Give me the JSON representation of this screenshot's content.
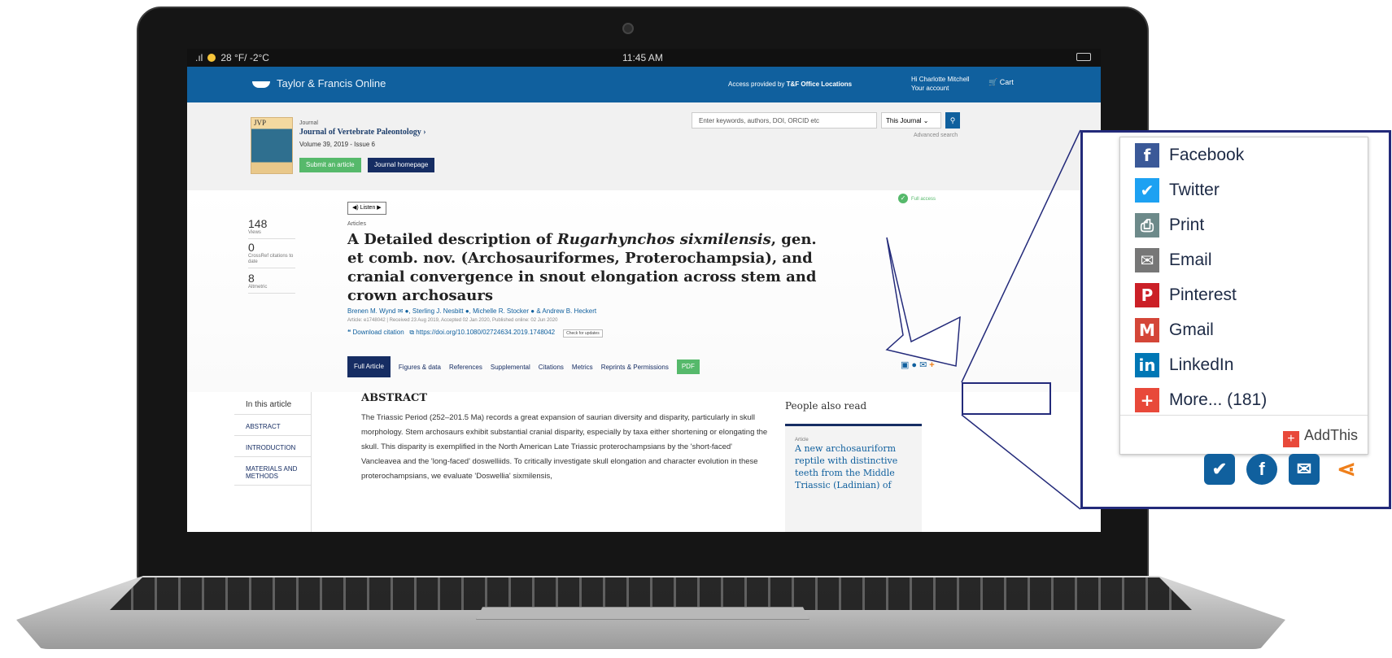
{
  "status": {
    "signal": ".ıl",
    "weather": "28 °F/ -2°C",
    "time": "11:45 AM"
  },
  "header": {
    "brand": "Taylor & Francis Online",
    "access_prefix": "Access provided by ",
    "access_org": "T&F Office Locations",
    "user_greeting": "Hi Charlotte Mitchell",
    "account_label": "Your account",
    "cart": "Cart"
  },
  "journal": {
    "label": "Journal",
    "cover_text": "JVP",
    "title": "Journal of Vertebrate Paleontology ›",
    "volume": "Volume 39, 2019 - Issue 6",
    "submit": "Submit an article",
    "homepage": "Journal homepage"
  },
  "search": {
    "placeholder": "Enter keywords, authors, DOI, ORCID etc",
    "scope": "This Journal",
    "advanced": "Advanced search"
  },
  "metrics": [
    {
      "value": "148",
      "label": "Views"
    },
    {
      "value": "0",
      "label": "CrossRef citations to date"
    },
    {
      "value": "8",
      "label": "Altmetric"
    }
  ],
  "article": {
    "listen": "◀) Listen  ▶",
    "type": "Articles",
    "full_access": "Full access",
    "title_before": "A Detailed description of ",
    "title_italic": "Rugarhynchos sixmilensis",
    "title_after": ", gen. et comb. nov. (Archosauriformes, Proterochampsia), and cranial convergence in snout elongation across stem and crown archosaurs",
    "authors": "Brenen M. Wynd ✉ ●, Sterling J. Nesbitt ●, Michelle R. Stocker ● & Andrew B. Heckert",
    "meta": "Article: e1748042 | Received 23 Aug 2019, Accepted 02 Jan 2020, Published online: 02 Jun 2020",
    "download": "❝ Download citation",
    "doi": "https://doi.org/10.1080/02724634.2019.1748042",
    "check": "Check for updates"
  },
  "tabs": [
    "Full Article",
    "Figures & data",
    "References",
    "Supplemental",
    "Citations",
    "Metrics",
    "Reprints & Permissions",
    "PDF"
  ],
  "toc": {
    "heading": "In this article",
    "items": [
      "ABSTRACT",
      "INTRODUCTION",
      "MATERIALS AND METHODS"
    ]
  },
  "abstract": {
    "heading": "ABSTRACT",
    "text": "The Triassic Period (252–201.5 Ma) records a great expansion of saurian diversity and disparity, particularly in skull morphology. Stem archosaurs exhibit substantial cranial disparity, especially by taxa either shortening or elongating the skull. This disparity is exemplified in the North American Late Triassic proterochampsians by the 'short-faced' Vancleavea and the 'long-faced' doswelliids. To critically investigate skull elongation and character evolution in these proterochampsians, we evaluate 'Doswellia' sixmilensis,"
  },
  "also_read": {
    "heading": "People also read",
    "type": "Article",
    "title": "A new archosauriform reptile with distinctive teeth from the Middle Triassic (Ladinian) of"
  },
  "share_menu": {
    "items": [
      "Facebook",
      "Twitter",
      "Print",
      "Email",
      "Pinterest",
      "Gmail",
      "LinkedIn",
      "More... (181)"
    ],
    "footer": "AddThis"
  },
  "colors": {
    "brand_blue": "#10609e",
    "navy": "#162d63",
    "green": "#56b96b",
    "callout": "#232a7a",
    "addthis": "#ef7f1a"
  }
}
